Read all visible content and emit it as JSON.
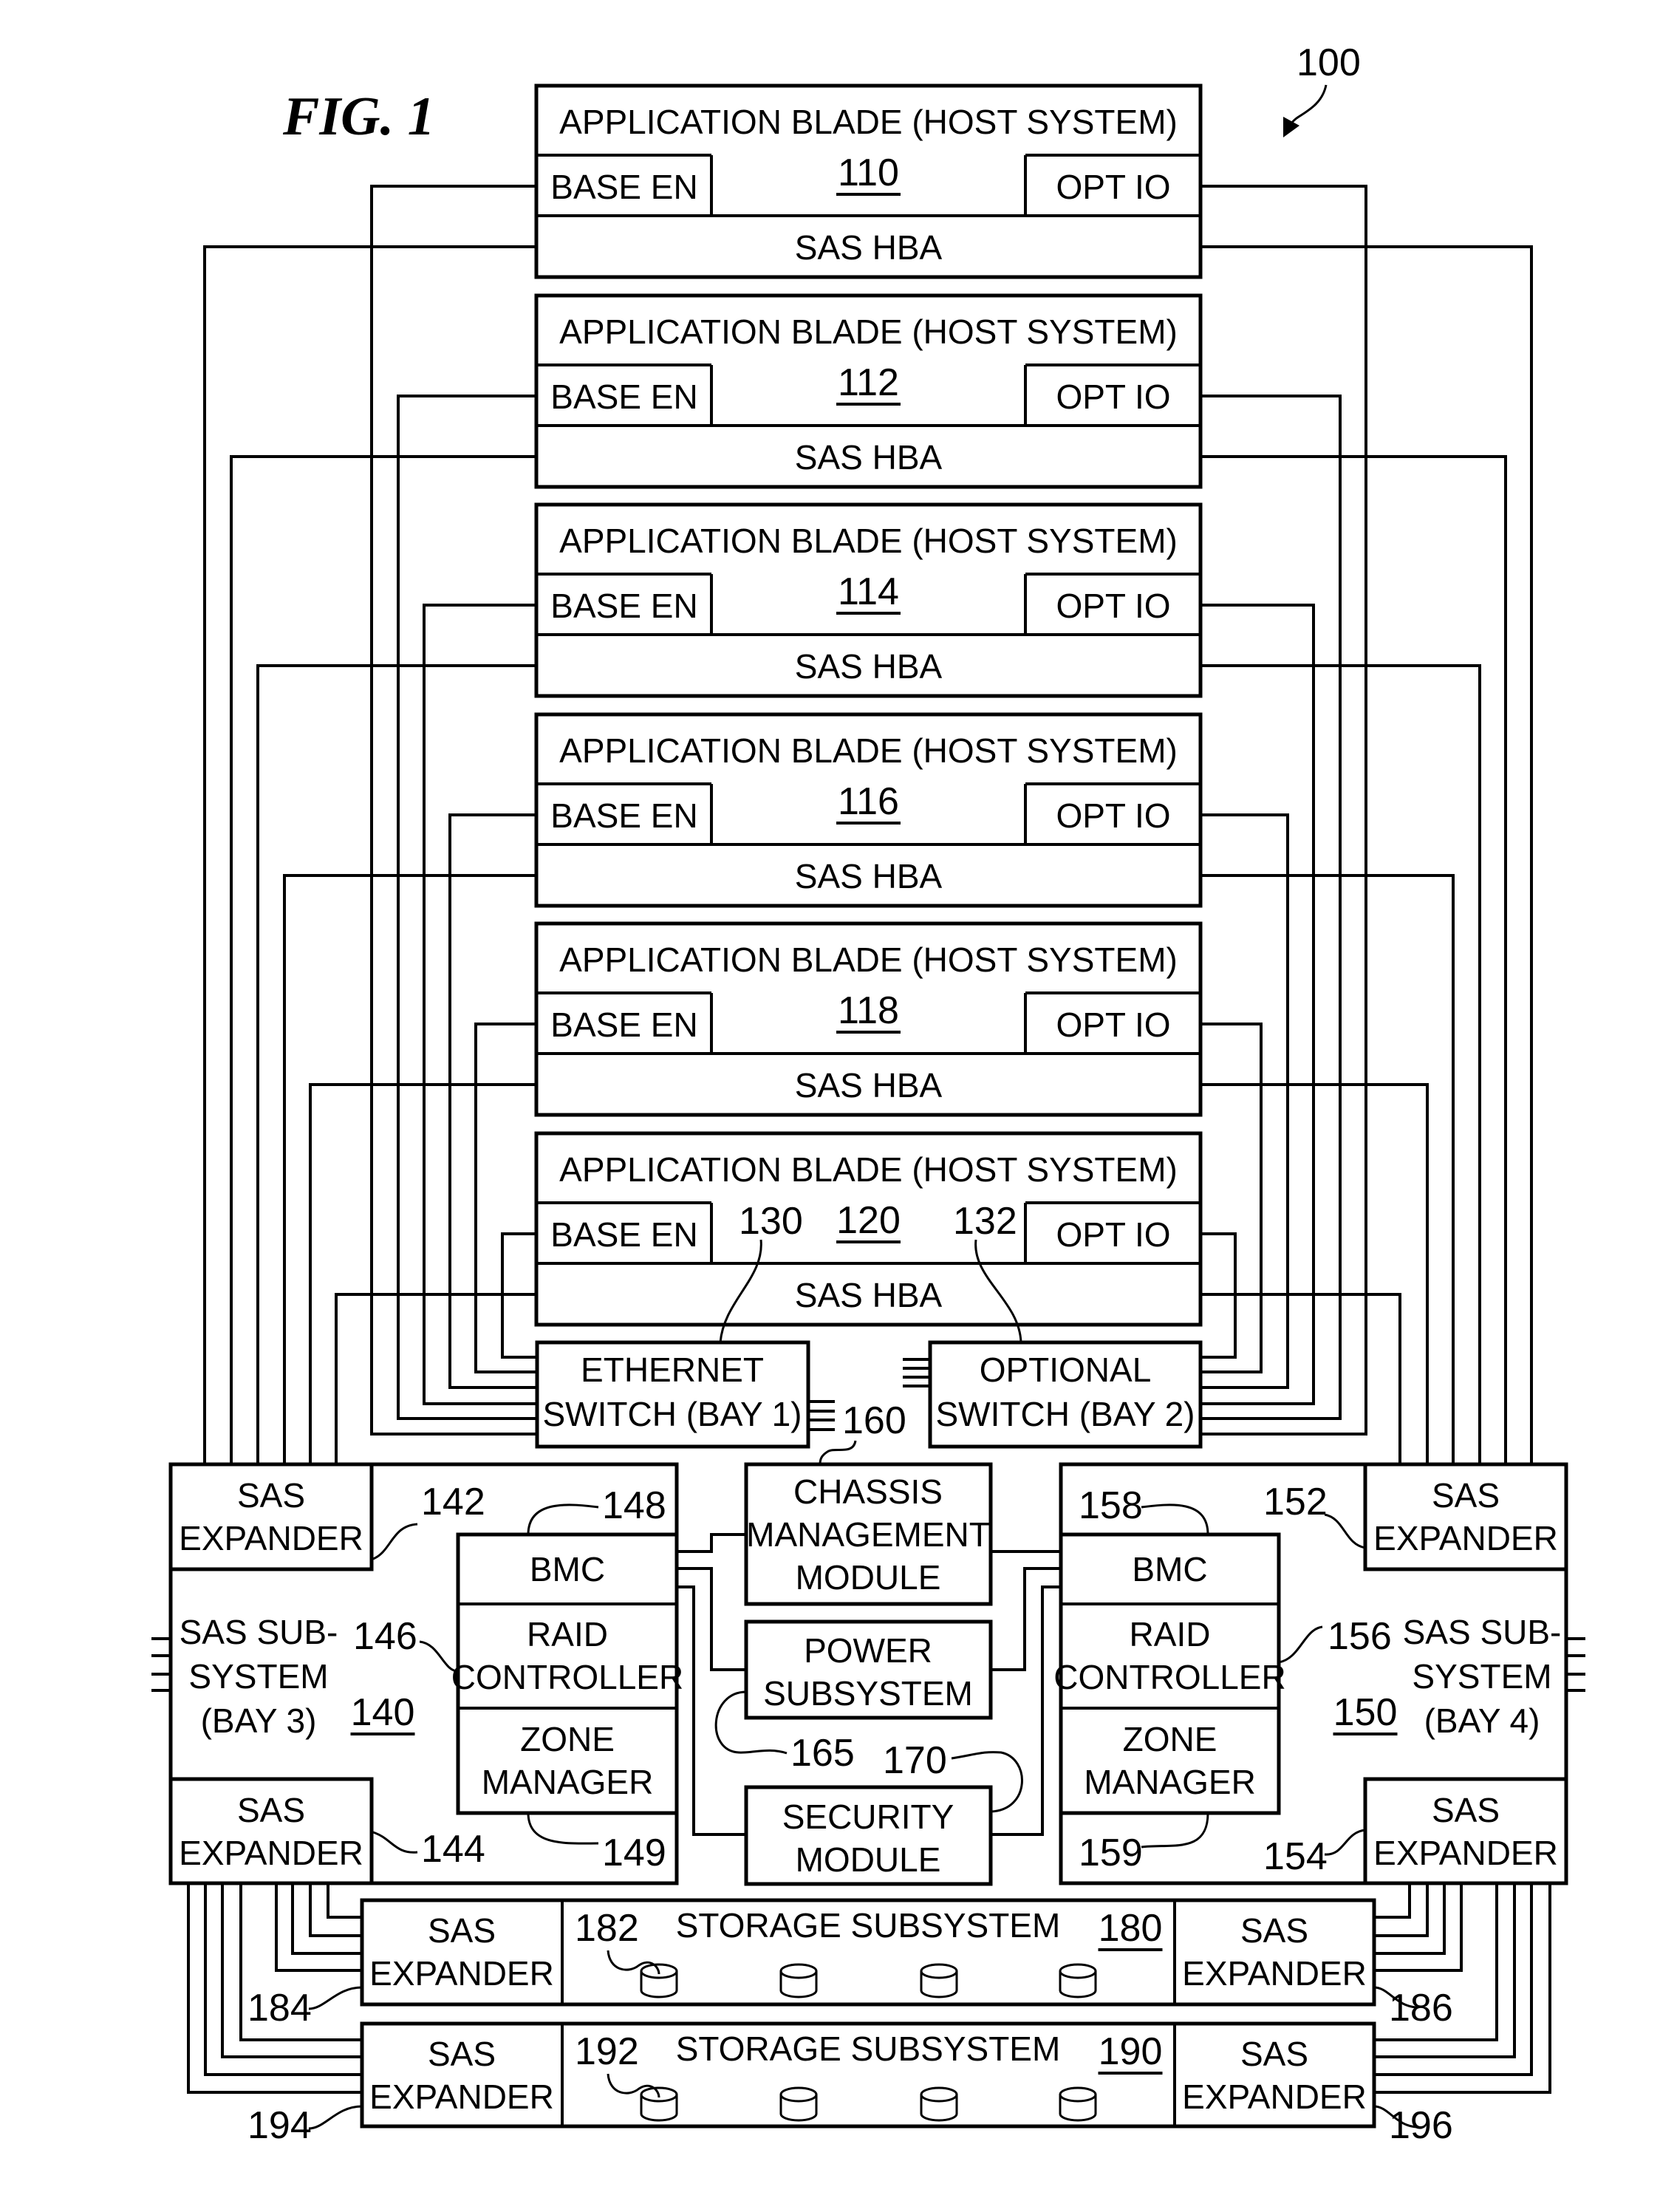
{
  "figure": {
    "title": "FIG. 1",
    "system_ref": "100"
  },
  "blades": [
    {
      "title": "APPLICATION BLADE (HOST SYSTEM)",
      "ref": "110",
      "base_en": "BASE EN",
      "opt_io": "OPT IO",
      "sas_hba": "SAS HBA"
    },
    {
      "title": "APPLICATION BLADE (HOST SYSTEM)",
      "ref": "112",
      "base_en": "BASE EN",
      "opt_io": "OPT IO",
      "sas_hba": "SAS HBA"
    },
    {
      "title": "APPLICATION BLADE (HOST SYSTEM)",
      "ref": "114",
      "base_en": "BASE EN",
      "opt_io": "OPT IO",
      "sas_hba": "SAS HBA"
    },
    {
      "title": "APPLICATION BLADE (HOST SYSTEM)",
      "ref": "116",
      "base_en": "BASE EN",
      "opt_io": "OPT IO",
      "sas_hba": "SAS HBA"
    },
    {
      "title": "APPLICATION BLADE (HOST SYSTEM)",
      "ref": "118",
      "base_en": "BASE EN",
      "opt_io": "OPT IO",
      "sas_hba": "SAS HBA"
    },
    {
      "title": "APPLICATION BLADE (HOST SYSTEM)",
      "ref": "120",
      "base_en": "BASE EN",
      "opt_io": "OPT IO",
      "sas_hba": "SAS HBA"
    }
  ],
  "switches": {
    "ethernet": {
      "line1": "ETHERNET",
      "line2": "SWITCH (BAY 1)",
      "ref": "130"
    },
    "optional": {
      "line1": "OPTIONAL",
      "line2": "SWITCH (BAY 2)",
      "ref": "132"
    }
  },
  "sas_subsystems": {
    "left": {
      "line1": "SAS SUB-",
      "line2": "SYSTEM",
      "line3": "(BAY 3)",
      "ref": "140",
      "expander_top": {
        "line1": "SAS",
        "line2": "EXPANDER",
        "ref": "142"
      },
      "expander_bottom": {
        "line1": "SAS",
        "line2": "EXPANDER",
        "ref": "144"
      },
      "bmc": "BMC",
      "bmc_ref": "148",
      "raid_line1": "RAID",
      "raid_line2": "CONTROLLER",
      "raid_ref": "146",
      "zone_line1": "ZONE",
      "zone_line2": "MANAGER",
      "zone_ref": "149"
    },
    "right": {
      "line1": "SAS SUB-",
      "line2": "SYSTEM",
      "line3": "(BAY 4)",
      "ref": "150",
      "expander_top": {
        "line1": "SAS",
        "line2": "EXPANDER",
        "ref": "152"
      },
      "expander_bottom": {
        "line1": "SAS",
        "line2": "EXPANDER",
        "ref": "154"
      },
      "bmc": "BMC",
      "bmc_ref": "158",
      "raid_line1": "RAID",
      "raid_line2": "CONTROLLER",
      "raid_ref": "156",
      "zone_line1": "ZONE",
      "zone_line2": "MANAGER",
      "zone_ref": "159"
    }
  },
  "center_modules": {
    "cmm": {
      "line1": "CHASSIS",
      "line2": "MANAGEMENT",
      "line3": "MODULE",
      "ref": "160"
    },
    "power": {
      "line1": "POWER",
      "line2": "SUBSYSTEM",
      "ref": "165"
    },
    "security": {
      "line1": "SECURITY",
      "line2": "MODULE",
      "ref": "170"
    }
  },
  "storage": [
    {
      "title": "STORAGE SUBSYSTEM",
      "ref": "180",
      "disk_ref": "182",
      "disk_count": 4,
      "left_expander": {
        "line1": "SAS",
        "line2": "EXPANDER",
        "ref": "184"
      },
      "right_expander": {
        "line1": "SAS",
        "line2": "EXPANDER",
        "ref": "186"
      }
    },
    {
      "title": "STORAGE SUBSYSTEM",
      "ref": "190",
      "disk_ref": "192",
      "disk_count": 4,
      "left_expander": {
        "line1": "SAS",
        "line2": "EXPANDER",
        "ref": "194"
      },
      "right_expander": {
        "line1": "SAS",
        "line2": "EXPANDER",
        "ref": "196"
      }
    }
  ]
}
